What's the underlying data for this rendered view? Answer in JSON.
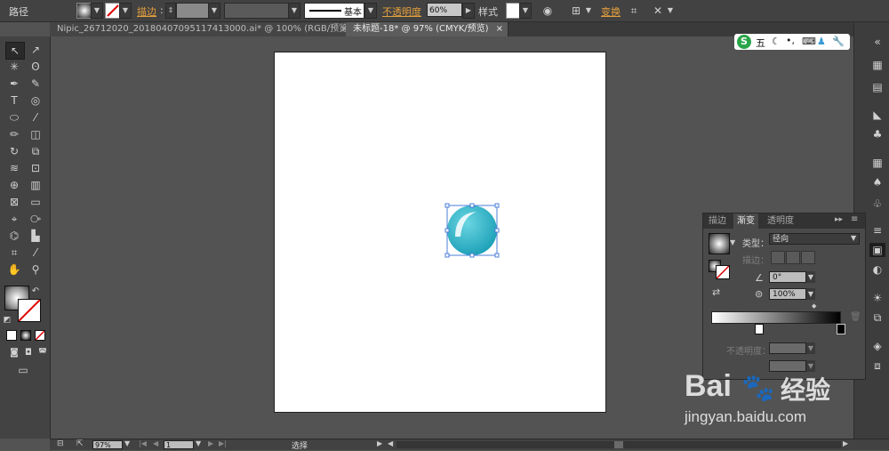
{
  "control_bar": {
    "object_type": "路径",
    "stroke_label": "描边",
    "stroke_profile": "基本",
    "opacity_label": "不透明度",
    "opacity_value": "60%",
    "style_label": "样式",
    "transform_label": "变换"
  },
  "tabs": [
    {
      "label": "Nipic_26712020_20180407095117413000.ai* @ 100% (RGB/预览)",
      "close": "×"
    },
    {
      "label": "未标题-18* @ 97% (CMYK/预览)",
      "close": "×"
    }
  ],
  "ime": {
    "brand": "S",
    "mode": "五"
  },
  "gradient_panel": {
    "tabs": [
      "描边",
      "渐变",
      "透明度"
    ],
    "type_label": "类型：",
    "type_value": "径向",
    "stroke_label": "描边：",
    "angle_value": "0°",
    "ratio_value": "100%",
    "opacity_label": "不透明度："
  },
  "status_bar": {
    "zoom": "97%",
    "page": "1",
    "tool": "选择"
  },
  "watermark": {
    "brand": "Bai",
    "brand2": "经验",
    "url": "jingyan.baidu.com"
  },
  "colors": {
    "circle_light": "#5ed1de",
    "circle_dark": "#199fb7",
    "accent_orange": "#e6a03c"
  }
}
